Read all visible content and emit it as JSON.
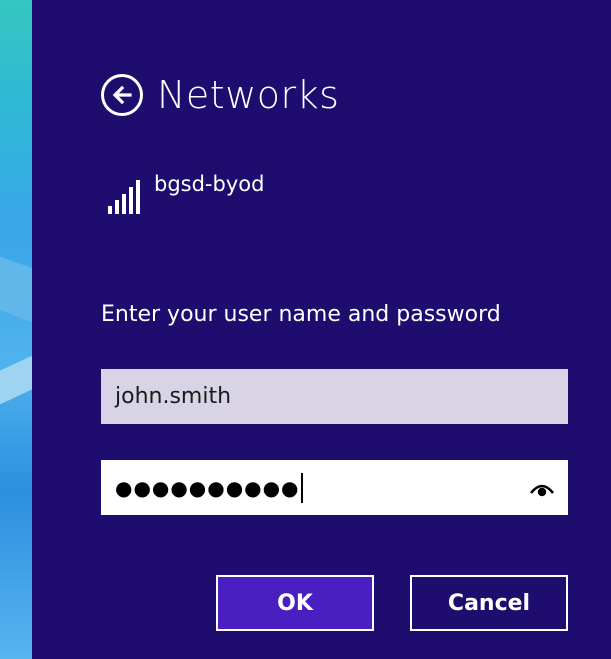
{
  "header": {
    "title": "Networks",
    "back_icon": "back-arrow-circle-icon"
  },
  "network": {
    "name": "bgsd-byod",
    "signal_icon": "wifi-signal-bars-icon",
    "signal_bars": 5
  },
  "form": {
    "prompt": "Enter your user name and password",
    "username_value": "john.smith",
    "password_masked": "●●●●●●●●●●",
    "reveal_icon": "eye-reveal-icon"
  },
  "buttons": {
    "ok_label": "OK",
    "cancel_label": "Cancel"
  },
  "colors": {
    "panel": "#1e0d6e",
    "ok_button": "#4a1fc1",
    "username_bg": "#d8d4e6"
  }
}
